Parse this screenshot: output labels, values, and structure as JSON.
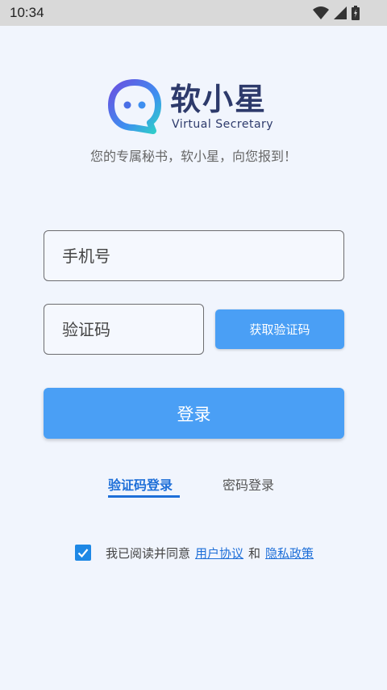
{
  "status_bar": {
    "time": "10:34",
    "icons": [
      "wifi-icon",
      "cell-signal-icon",
      "battery-icon"
    ]
  },
  "brand": {
    "name": "软小星",
    "subtitle": "Virtual Secretary",
    "slogan": "您的专属秘书，软小星，向您报到！"
  },
  "form": {
    "phone_placeholder": "手机号",
    "code_placeholder": "验证码",
    "get_code_label": "获取验证码",
    "login_label": "登录"
  },
  "tabs": [
    {
      "label": "验证码登录",
      "active": true
    },
    {
      "label": "密码登录",
      "active": false
    }
  ],
  "agreement": {
    "checked": true,
    "prefix": "我已阅读并同意",
    "user_agreement": "用户协议",
    "and": "和",
    "privacy_policy": "隐私政策"
  },
  "colors": {
    "accent": "#4a9ff5",
    "link": "#1e6fd8",
    "brand_text": "#2d3a6b",
    "background": "#f1f5fd"
  }
}
